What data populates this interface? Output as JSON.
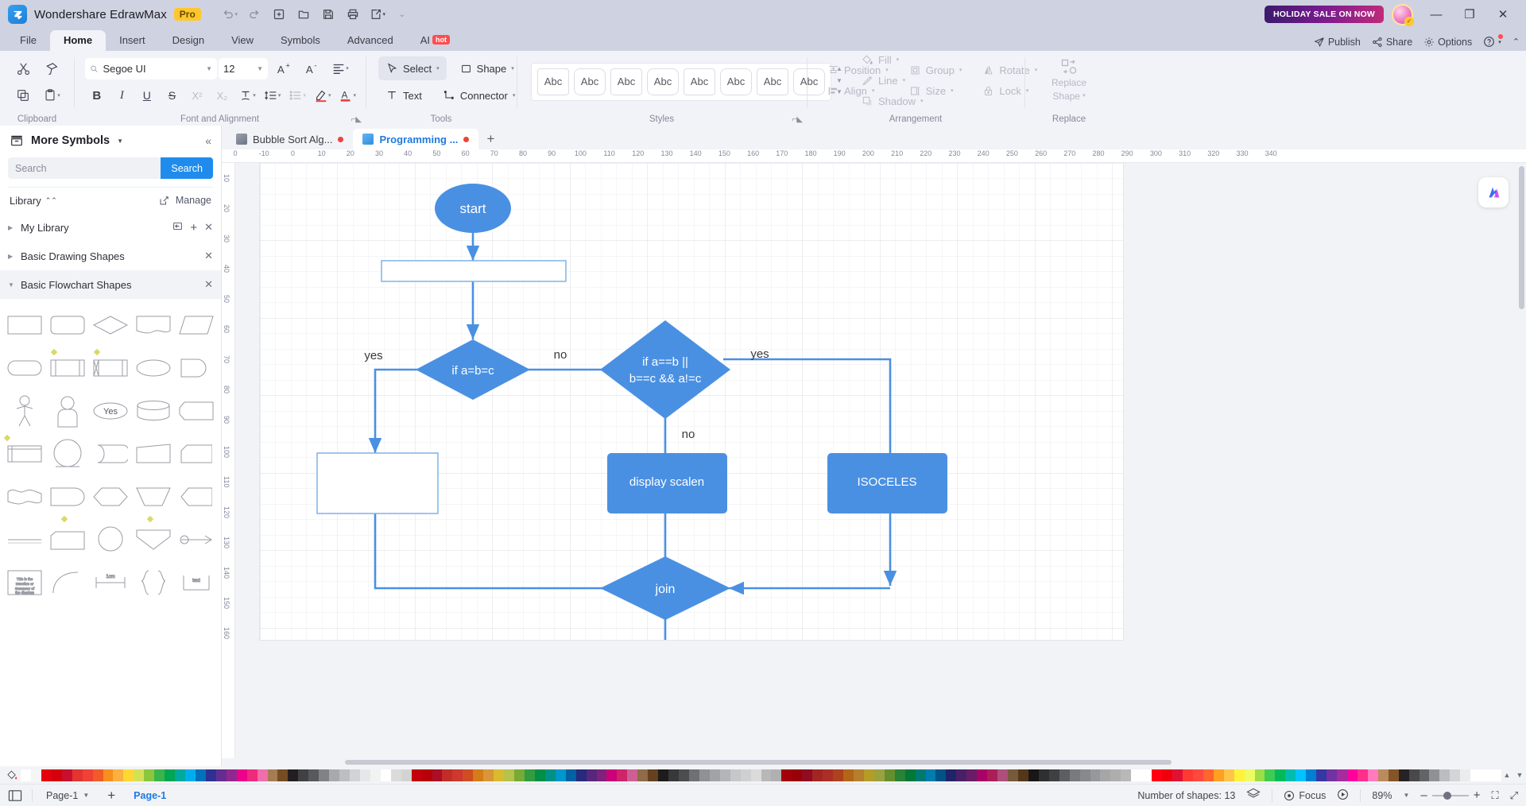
{
  "app": {
    "title": "Wondershare EdrawMax",
    "edition_badge": "Pro",
    "promo_badge": "HOLIDAY SALE ON NOW"
  },
  "quick_access": [
    {
      "name": "undo-icon",
      "glyph": "↶"
    },
    {
      "name": "redo-icon",
      "glyph": "↷"
    },
    {
      "name": "new-icon",
      "glyph": "⊞"
    },
    {
      "name": "open-icon",
      "glyph": "🗁"
    },
    {
      "name": "save-icon",
      "glyph": "🖫"
    },
    {
      "name": "print-icon",
      "glyph": "🖨"
    },
    {
      "name": "export-icon",
      "glyph": "🗗"
    },
    {
      "name": "more-icon",
      "glyph": "⌄"
    }
  ],
  "menu": {
    "tabs": [
      "File",
      "Home",
      "Insert",
      "Design",
      "View",
      "Symbols",
      "Advanced",
      "AI"
    ],
    "active": "Home",
    "ai_badge": "hot",
    "right_items": [
      "Publish",
      "Share",
      "Options"
    ]
  },
  "window_controls": {
    "minimize": "—",
    "maximize": "❐",
    "close": "✕"
  },
  "ribbon": {
    "groups": [
      {
        "name": "Clipboard",
        "label": "Clipboard"
      },
      {
        "name": "Font and Alignment",
        "label": "Font and Alignment"
      },
      {
        "name": "Tools",
        "label": "Tools"
      },
      {
        "name": "Styles",
        "label": "Styles"
      },
      {
        "name": "Arrangement",
        "label": "Arrangement"
      },
      {
        "name": "Replace",
        "label": "Replace"
      }
    ],
    "font": {
      "family": "Segoe UI",
      "size": "12"
    },
    "tools": {
      "select": "Select",
      "shape": "Shape",
      "text": "Text",
      "connector": "Connector"
    },
    "styles": {
      "sample_label": "Abc",
      "count": 8
    },
    "format": {
      "fill": "Fill",
      "line": "Line",
      "shadow": "Shadow"
    },
    "arrangement": {
      "position": "Position",
      "group": "Group",
      "rotate": "Rotate",
      "align": "Align",
      "size": "Size",
      "lock": "Lock"
    },
    "replace": {
      "line1": "Replace",
      "line2": "Shape"
    }
  },
  "sidebar": {
    "panel_title": "More Symbols",
    "search": {
      "placeholder": "Search",
      "button": "Search",
      "value": ""
    },
    "library_label": "Library",
    "manage_label": "Manage",
    "categories": [
      {
        "label": "My Library",
        "open": false,
        "has_actions": true
      },
      {
        "label": "Basic Drawing Shapes",
        "open": false,
        "has_actions": false
      },
      {
        "label": "Basic Flowchart Shapes",
        "open": true,
        "has_actions": false
      }
    ],
    "shapes": [
      "process-rectangle",
      "rounded-rectangle",
      "decision-diamond",
      "document",
      "data-parallelogram",
      "terminator",
      "predefined-process",
      "internal-storage",
      "ellipse",
      "delay",
      "actor-person",
      "user-person",
      "yes-oval",
      "database-cylinder",
      "card",
      "direct-data",
      "circle-connector",
      "stored-data",
      "trapezoid-flag",
      "tape-rounded",
      "wave-document",
      "tagged-document",
      "rounded-hexagon",
      "inverted-trapezoid",
      "chevron-left",
      "line-shape",
      "sequential-data",
      "off-page-circle",
      "merge-triangle",
      "control-transfer"
    ]
  },
  "doc_tabs": {
    "tabs": [
      {
        "label": "Bubble Sort Alg...",
        "active": false,
        "modified": true
      },
      {
        "label": "Programming ...",
        "active": true,
        "modified": true
      }
    ],
    "add_label": "+"
  },
  "rulers": {
    "horizontal": [
      "0",
      "-10",
      "0",
      "10",
      "20",
      "30",
      "40",
      "50",
      "60",
      "70",
      "80",
      "90",
      "100",
      "110",
      "120",
      "130",
      "140",
      "150",
      "160",
      "170",
      "180",
      "190",
      "200",
      "210",
      "220",
      "230",
      "240",
      "250",
      "260",
      "270",
      "280",
      "290",
      "300",
      "310",
      "320",
      "330",
      "340"
    ],
    "vertical": [
      "10",
      "20",
      "30",
      "40",
      "50",
      "60",
      "70",
      "80",
      "90",
      "100",
      "110",
      "120",
      "130",
      "140",
      "150",
      "160"
    ]
  },
  "diagram": {
    "accent_color": "#4a90e2",
    "nodes": [
      {
        "id": "start",
        "type": "ellipse",
        "label": "start"
      },
      {
        "id": "blank-process",
        "type": "rect-empty",
        "label": ""
      },
      {
        "id": "cond1",
        "type": "diamond",
        "label": "if a=b=c"
      },
      {
        "id": "cond2",
        "type": "diamond",
        "label": "if a==b ||\nb==c && a!=c"
      },
      {
        "id": "blank-box",
        "type": "rect-empty",
        "label": ""
      },
      {
        "id": "display-scalen",
        "type": "rect",
        "label": "display scalen"
      },
      {
        "id": "isoceles",
        "type": "rect",
        "label": "ISOCELES"
      },
      {
        "id": "join",
        "type": "diamond",
        "label": "join"
      }
    ],
    "edge_labels": [
      "yes",
      "no",
      "yes",
      "no"
    ]
  },
  "palette": {
    "colors": [
      "#ffffff",
      "#f5f5f5",
      "#e3000f",
      "#d6000c",
      "#c8102e",
      "#e3342f",
      "#ef4136",
      "#f15a29",
      "#f78f1e",
      "#fbb040",
      "#fdd835",
      "#d4e157",
      "#8cc63f",
      "#39b54a",
      "#00a651",
      "#00a99d",
      "#00aeef",
      "#0072bc",
      "#2e3192",
      "#662d91",
      "#92278f",
      "#ed008c",
      "#ee2a7b",
      "#f06eaa",
      "#a67c52",
      "#754c24",
      "#231f20",
      "#414042",
      "#58595b",
      "#808285",
      "#a7a9ac",
      "#bcbec0",
      "#d1d3d4",
      "#e6e7e8",
      "#f1f2f2",
      "#ffffff"
    ]
  },
  "status": {
    "page_label": "Page-1",
    "add_page": "+",
    "current_page": "Page-1",
    "shape_count": "Number of shapes: 13",
    "focus": "Focus",
    "zoom": "89%",
    "zoom_out": "–",
    "zoom_in": "+",
    "fit": "⛶",
    "fullscreen": "⤢"
  }
}
